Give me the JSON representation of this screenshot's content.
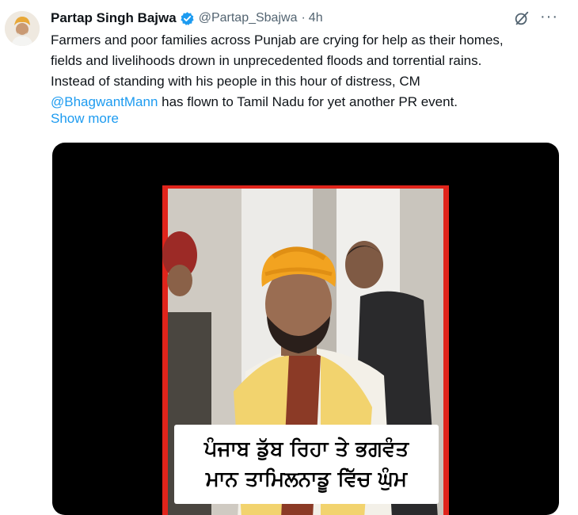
{
  "author": {
    "name": "Partap Singh Bajwa",
    "handle": "@Partap_Sbajwa",
    "separator": "·",
    "time": "4h"
  },
  "header_icons": {
    "grok": "grok-icon",
    "more": "···"
  },
  "tweet": {
    "line1": "Farmers and poor families across Punjab are crying for help as their homes,",
    "line2": "fields and livelihoods drown in unprecedented floods and torrential rains.",
    "line3": "Instead of standing with his people in this hour of distress, CM",
    "mention": "@BhagwantMann",
    "line4_rest": " has flown to Tamil Nadu for yet another PR event.",
    "show_more": "Show more"
  },
  "media": {
    "caption_line1": "ਪੰਜਾਬ ਡੁੱਬ ਰਿਹਾ ਤੇ ਭਗਵੰਤ",
    "caption_line2": "ਮਾਨ ਤਾਮਿਲਨਾਡੂ ਵਿੱਚ ਘੁੰਮ",
    "border_color": "#e0241b",
    "turban_color": "#f2a320"
  },
  "colors": {
    "link": "#1d9bf0",
    "secondary": "#536471",
    "verified": "#1d9bf0"
  }
}
